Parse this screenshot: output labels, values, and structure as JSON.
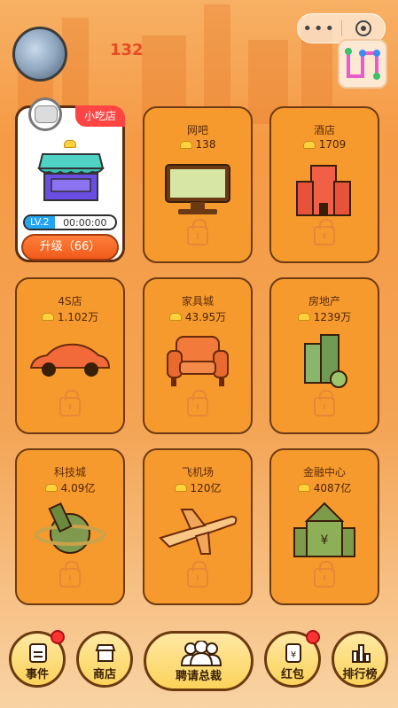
{
  "header": {
    "coins": "132",
    "avatar_caption": "BLANK"
  },
  "active_shop": {
    "tag": "小吃店",
    "level": "LV.2",
    "timer": "00:00:00",
    "upgrade_label": "升级（66）"
  },
  "shops": [
    {
      "name": "网吧",
      "cost": "138",
      "icon": "monitor-icon"
    },
    {
      "name": "酒店",
      "cost": "1709",
      "icon": "hotel-icon"
    },
    {
      "name": "4S店",
      "cost": "1.102万",
      "icon": "car-icon"
    },
    {
      "name": "家具城",
      "cost": "43.95万",
      "icon": "armchair-icon"
    },
    {
      "name": "房地产",
      "cost": "1239万",
      "icon": "building-icon"
    },
    {
      "name": "科技城",
      "cost": "4.09亿",
      "icon": "planet-icon"
    },
    {
      "name": "飞机场",
      "cost": "120亿",
      "icon": "airplane-icon"
    },
    {
      "name": "金融中心",
      "cost": "4087亿",
      "icon": "bank-icon"
    }
  ],
  "nav": {
    "events": "事件",
    "store": "商店",
    "hire": "聘请总裁",
    "redpacket": "红包",
    "ranking": "排行榜"
  },
  "colors": {
    "card": "#f79a2d",
    "accent_red": "#f44444",
    "level_blue": "#22a4f0"
  }
}
